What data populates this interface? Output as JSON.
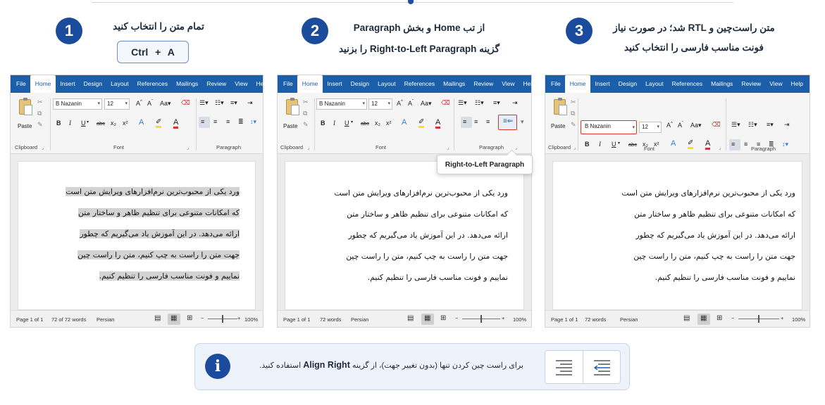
{
  "steps": [
    {
      "number": "1",
      "line1": "تمام متن را انتخاب کنید",
      "line2": ""
    },
    {
      "number": "2",
      "line1": "از تب Home و بخش Paragraph",
      "line2": "گزینه Right-to-Left Paragraph را بزنید"
    },
    {
      "number": "3",
      "line1": "متن راست‌چین و RTL شد؛ در صورت نیاز",
      "line2": "فونت مناسب فارسی را انتخاب کنید"
    }
  ],
  "shortcut": {
    "text": "Ctrl + A"
  },
  "word": {
    "tabs": [
      "File",
      "Home",
      "Insert",
      "Design",
      "Layout",
      "References",
      "Mailings",
      "Review",
      "View",
      "Help"
    ],
    "font_name": "B Nazanin",
    "font_size": "12",
    "paste_label": "Paste",
    "groups": {
      "clipboard": "Clipboard",
      "font": "Font",
      "paragraph": "Paragraph"
    },
    "font_buttons": {
      "bold": "B",
      "italic": "I",
      "underline": "U",
      "strike": "abc",
      "sub": "x₂",
      "sup": "x²",
      "grow": "A^",
      "shrink": "A˅",
      "case": "Aa"
    },
    "doc_lines": [
      "ورد یکی از محبوب‌ترین نرم‌افزارهای ویرایش متن است",
      "که امکانات متنوعی برای تنظیم ظاهر و ساختار متن",
      "ارائه می‌دهد. در این آموزش یاد می‌گیریم که چطور",
      "جهت متن را راست به چپ کنیم، متن را راست چین",
      "نماییم و فونت مناسب فارسی را تنظیم کنیم."
    ],
    "status": [
      {
        "page": "Page 1 of 1",
        "words": "72 of 72 words",
        "lang": "Persian",
        "zoom": "100%"
      },
      {
        "page": "Page 1 of 1",
        "words": "72 words",
        "lang": "Persian",
        "zoom": "100%"
      },
      {
        "page": "Page 1 of 1",
        "words": "72 words",
        "lang": "Persian",
        "zoom": "100%"
      }
    ],
    "tooltip": "Right-to-Left Paragraph"
  },
  "info": {
    "text_before": "برای راست چین کردن تنها (بدون تغییر جهت)، از گزینه",
    "bold": "Align Right",
    "text_after": "استفاده کنید."
  },
  "colors": {
    "brand_blue": "#1a4b9c",
    "ribbon_blue": "#1b5faa",
    "highlight_red": "#d9342b",
    "selection_gray": "#d3d3d3"
  }
}
